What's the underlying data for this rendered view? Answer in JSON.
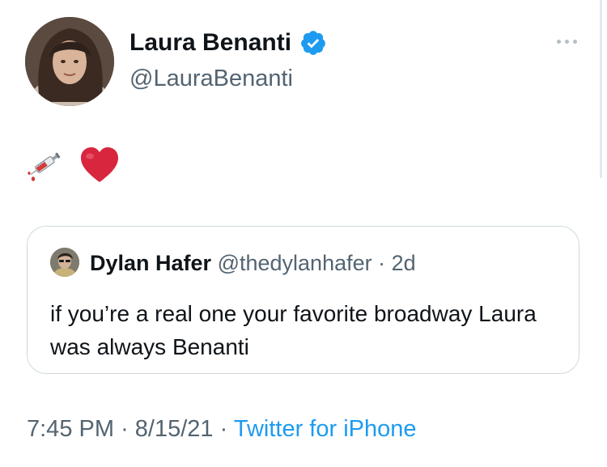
{
  "author": {
    "name": "Laura Benanti",
    "handle": "@LauraBenanti",
    "verified_icon": "verified-badge-icon",
    "avatar_icon": "profile-photo"
  },
  "more_icon": "more-dots-icon",
  "tweet": {
    "emojis": [
      "syringe-emoji",
      "red-heart-emoji"
    ]
  },
  "quote": {
    "name": "Dylan Hafer",
    "handle": "@thedylanhafer",
    "separator": "·",
    "time": "2d",
    "text": "if you’re a real one your favorite broadway Laura was always Benanti"
  },
  "meta": {
    "time": "7:45 PM",
    "sep1": "·",
    "date": "8/15/21",
    "sep2": "·",
    "source": "Twitter for iPhone"
  },
  "colors": {
    "accent": "#1d9bf0",
    "muted": "#536471",
    "border": "#cfd9de"
  }
}
